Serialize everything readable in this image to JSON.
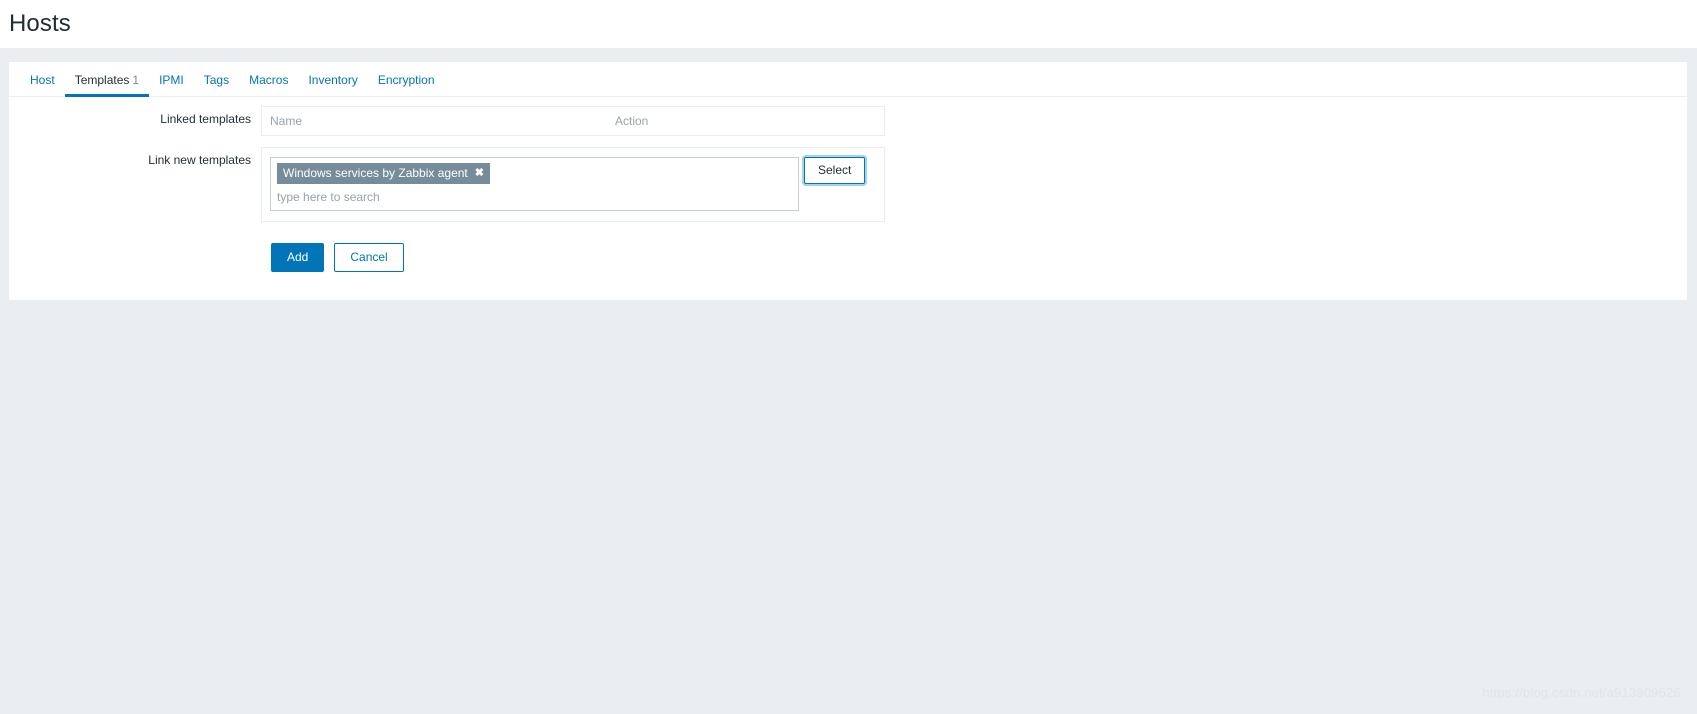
{
  "header": {
    "title": "Hosts"
  },
  "tabs": [
    {
      "label": "Host",
      "count": "",
      "active": false
    },
    {
      "label": "Templates",
      "count": "1",
      "active": true
    },
    {
      "label": "IPMI",
      "count": "",
      "active": false
    },
    {
      "label": "Tags",
      "count": "",
      "active": false
    },
    {
      "label": "Macros",
      "count": "",
      "active": false
    },
    {
      "label": "Inventory",
      "count": "",
      "active": false
    },
    {
      "label": "Encryption",
      "count": "",
      "active": false
    }
  ],
  "form": {
    "linked_templates": {
      "label": "Linked templates",
      "columns": {
        "name": "Name",
        "action": "Action"
      },
      "rows": []
    },
    "link_new_templates": {
      "label": "Link new templates",
      "chips": [
        {
          "label": "Windows services by Zabbix agent",
          "remove_icon": "✖"
        }
      ],
      "search_placeholder": "type here to search",
      "search_value": "",
      "select_button": "Select"
    }
  },
  "footer": {
    "add_label": "Add",
    "cancel_label": "Cancel"
  },
  "watermark": {
    "text": "https://blog.csdn.net/a913909626"
  },
  "colors": {
    "accent": "#0275b8",
    "chip_bg": "#768d99",
    "page_bg": "#eaeef1",
    "muted_text": "#97a3ab"
  }
}
